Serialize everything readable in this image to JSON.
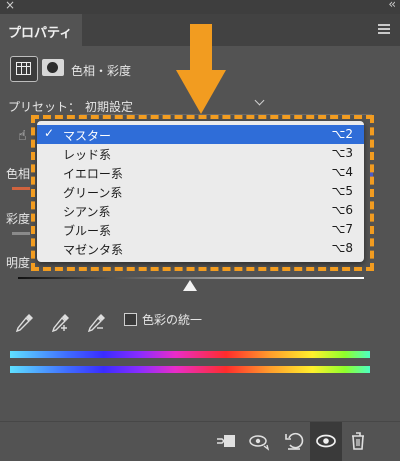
{
  "window": {
    "close_glyph": "×",
    "collapse_glyph": "‹‹"
  },
  "tabs": [
    {
      "label": "プロパティ"
    }
  ],
  "properties": {
    "title": "色相・彩度"
  },
  "preset": {
    "label": "プリセット：",
    "value": "初期設定"
  },
  "side_labels": {
    "hue": "色相",
    "saturation": "彩度",
    "lightness": "明度"
  },
  "dropdown": {
    "items": [
      {
        "label": "マスター",
        "shortcut": "⌥2",
        "selected": true,
        "check": "✓"
      },
      {
        "label": "レッド系",
        "shortcut": "⌥3"
      },
      {
        "label": "イエロー系",
        "shortcut": "⌥4"
      },
      {
        "label": "グリーン系",
        "shortcut": "⌥5"
      },
      {
        "label": "シアン系",
        "shortcut": "⌥6"
      },
      {
        "label": "ブルー系",
        "shortcut": "⌥7"
      },
      {
        "label": "マゼンタ系",
        "shortcut": "⌥8"
      }
    ]
  },
  "colorize": {
    "label": "色彩の統一"
  },
  "colors": {
    "accent": "#2f6dd8",
    "highlight": "#f29c20",
    "panel": "#535353"
  },
  "icons": [
    "close-icon",
    "collapse-icon",
    "menu-icon",
    "adjustment-icon",
    "mask-icon",
    "hand-icon",
    "eyedropper-icon",
    "eyedropper-plus-icon",
    "eyedropper-minus-icon",
    "clip-to-layer-icon",
    "view-previous-icon",
    "reset-icon",
    "visibility-eye-icon",
    "trash-icon"
  ]
}
